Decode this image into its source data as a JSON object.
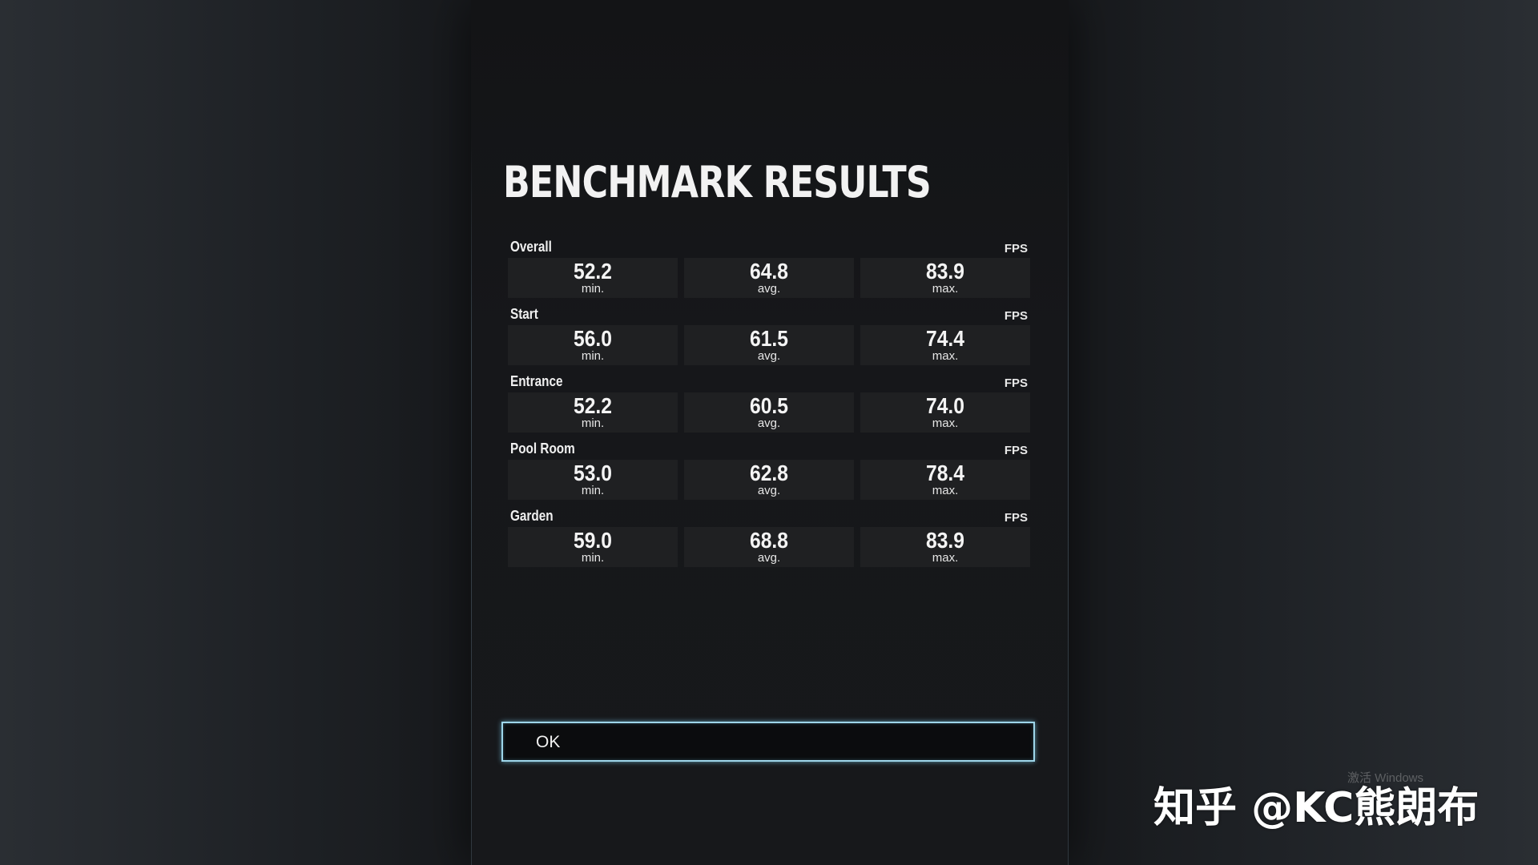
{
  "title": "BENCHMARK RESULTS",
  "unit_label": "FPS",
  "labels": {
    "min": "min.",
    "avg": "avg.",
    "max": "max."
  },
  "sections": [
    {
      "name": "Overall",
      "min": "52.2",
      "avg": "64.8",
      "max": "83.9"
    },
    {
      "name": "Start",
      "min": "56.0",
      "avg": "61.5",
      "max": "74.4"
    },
    {
      "name": "Entrance",
      "min": "52.2",
      "avg": "60.5",
      "max": "74.0"
    },
    {
      "name": "Pool Room",
      "min": "53.0",
      "avg": "62.8",
      "max": "78.4"
    },
    {
      "name": "Garden",
      "min": "59.0",
      "avg": "68.8",
      "max": "83.9"
    }
  ],
  "ok_label": "OK",
  "activation_text": "激活 Windows",
  "watermark": "知乎 @KC熊朗布"
}
